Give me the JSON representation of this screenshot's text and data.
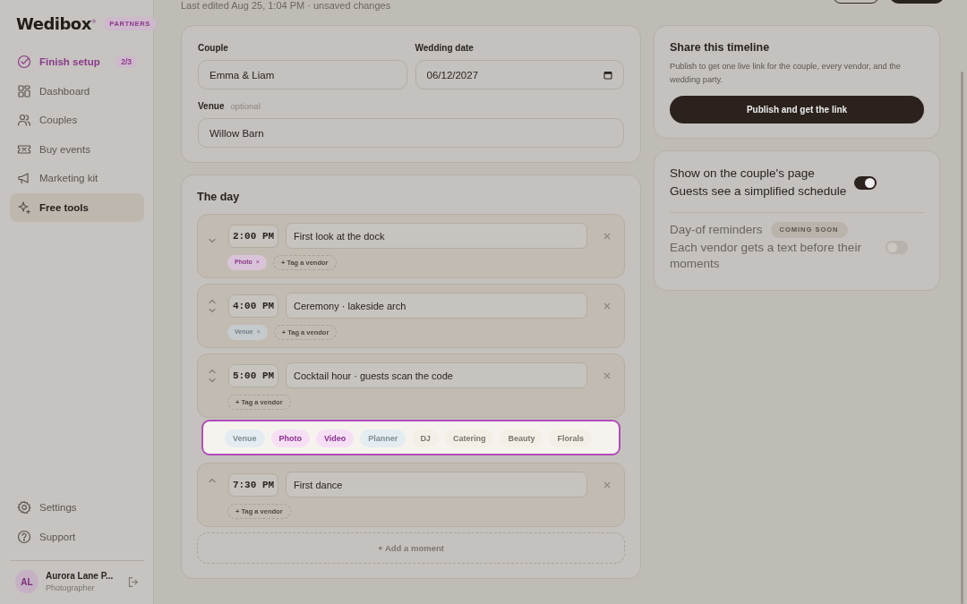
{
  "sidebar": {
    "logo": "Wedibox",
    "logo_mark": "®",
    "plan_badge": "PARTNERS",
    "items": [
      {
        "label": "Finish setup",
        "kind": "setup",
        "count": "2/3",
        "selected": false
      },
      {
        "label": "Dashboard",
        "kind": "dashboard",
        "selected": false
      },
      {
        "label": "Couples",
        "kind": "couples",
        "selected": false
      },
      {
        "label": "Buy events",
        "kind": "ticket",
        "selected": false
      },
      {
        "label": "Marketing kit",
        "kind": "megaphone",
        "selected": false
      },
      {
        "label": "Free tools",
        "kind": "sparkle",
        "selected": true
      }
    ],
    "footer_items": [
      {
        "label": "Settings",
        "kind": "settings"
      },
      {
        "label": "Support",
        "kind": "help"
      }
    ],
    "user": {
      "initials": "AL",
      "name": "Aurora Lane P...",
      "role": "Photographer"
    }
  },
  "status": "Last edited Aug 25, 1:04 PM · unsaved changes",
  "details": {
    "couple_label": "Couple",
    "couple_value": "Emma & Liam",
    "date_label": "Wedding date",
    "date_value": "06/12/2027",
    "venue_label": "Venue",
    "venue_hint": "optional",
    "venue_value": "Willow Barn"
  },
  "day": {
    "title": "The day",
    "moments": [
      {
        "time": "2:00 PM",
        "title": "First look at the dock",
        "can_move_up": false,
        "can_move_down": true,
        "tags": [
          {
            "label": "Photo",
            "remove": "×",
            "color": "#d9c3d8"
          }
        ],
        "tag_button": "+ Tag a vendor"
      },
      {
        "time": "4:00 PM",
        "title": "Ceremony · lakeside arch",
        "can_move_up": true,
        "can_move_down": true,
        "tags": [
          {
            "label": "Venue",
            "remove": "×",
            "color": "#c5cacd"
          }
        ],
        "tag_button": "+ Tag a vendor"
      },
      {
        "time": "5:00 PM",
        "title": "Cocktail hour · guests scan the code",
        "can_move_up": true,
        "can_move_down": true,
        "tag_button": "+ Tag a vendor",
        "picker_open": true
      },
      {
        "time": "7:30 PM",
        "title": "First dance",
        "can_move_up": true,
        "can_move_down": false,
        "tag_button": "+ Tag a vendor"
      }
    ],
    "vendor_options": [
      {
        "label": "Venue",
        "color": "#e3ecf0"
      },
      {
        "label": "Photo",
        "color": "#f6dff5"
      },
      {
        "label": "Video",
        "color": "#f6dff5"
      },
      {
        "label": "Planner",
        "color": "#e3ecf0"
      },
      {
        "label": "DJ",
        "color": "#f4efe6"
      },
      {
        "label": "Catering",
        "color": "#f4efe6"
      },
      {
        "label": "Beauty",
        "color": "#f4efe6"
      },
      {
        "label": "Florals",
        "color": "#f4efe6"
      }
    ],
    "add_button": "+ Add a moment"
  },
  "share": {
    "title": "Share this timeline",
    "text": "Publish to get one live link for the couple, every vendor, and the wedding party.",
    "button": "Publish and get the link"
  },
  "settings": {
    "toggles": [
      {
        "title": "Show on the couple's page",
        "text": "Guests see a simplified schedule",
        "on": true,
        "disabled": false
      },
      {
        "title": "Day-of reminders",
        "badge": "COMING SOON",
        "text": "Each vendor gets a text before their moments",
        "on": false,
        "disabled": true
      }
    ]
  }
}
